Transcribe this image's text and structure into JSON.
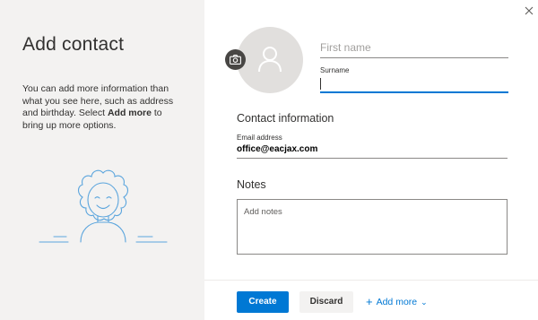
{
  "panel": {
    "title": "Add contact",
    "description_before": "You can add more information than what you see here, such as address and birthday. Select ",
    "description_bold": "Add more",
    "description_after": " to bring up more options."
  },
  "form": {
    "first_name_placeholder": "First name",
    "surname_label": "Surname",
    "contact_info_title": "Contact information",
    "email_label": "Email address",
    "email_value": "office@eacjax.com",
    "notes_title": "Notes",
    "notes_placeholder": "Add notes"
  },
  "footer": {
    "create_label": "Create",
    "discard_label": "Discard",
    "add_more_label": "Add more"
  },
  "icons": {
    "close": "close-icon",
    "camera": "camera-icon",
    "person": "person-icon",
    "plus": "plus-icon",
    "chevron": "chevron-down-icon"
  },
  "colors": {
    "accent": "#0078d4",
    "panel_bg": "#f3f2f1",
    "illustration": "#5ba5dd"
  }
}
